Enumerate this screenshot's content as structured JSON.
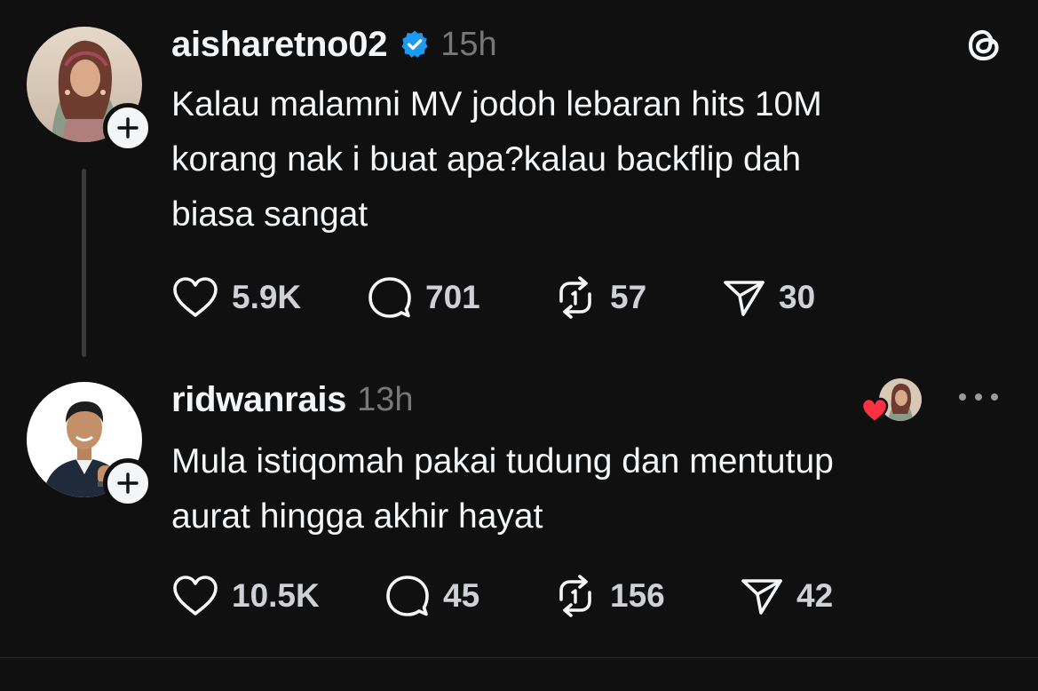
{
  "posts": [
    {
      "username": "aisharetno02",
      "verified": true,
      "time": "15h",
      "text_lines": [
        "Kalau malamni MV jodoh lebaran hits 10M",
        "korang nak i buat apa?kalau backflip dah",
        "biasa sangat"
      ],
      "likes": "5.9K",
      "replies": "701",
      "reposts": "57",
      "shares": "30"
    },
    {
      "username": "ridwanrais",
      "verified": false,
      "time": "13h",
      "text_lines": [
        "Mula istiqomah pakai tudung dan mentutup",
        "aurat hingga akhir hayat"
      ],
      "likes": "10.5K",
      "replies": "45",
      "reposts": "156",
      "shares": "42"
    }
  ],
  "icons": {
    "app_logo": "threads-logo-icon",
    "follow": "plus-icon",
    "verified": "verified-badge-icon",
    "like": "heart-icon",
    "reply": "comment-bubble-icon",
    "repost": "repost-icon",
    "share": "send-icon",
    "liked_by_author": "heart-filled-icon",
    "more": "more-horizontal-icon"
  },
  "colors": {
    "background": "#101010",
    "text": "#f3f5f7",
    "muted": "#777777",
    "verified": "#1d9bf0",
    "heart": "#ff3040"
  }
}
